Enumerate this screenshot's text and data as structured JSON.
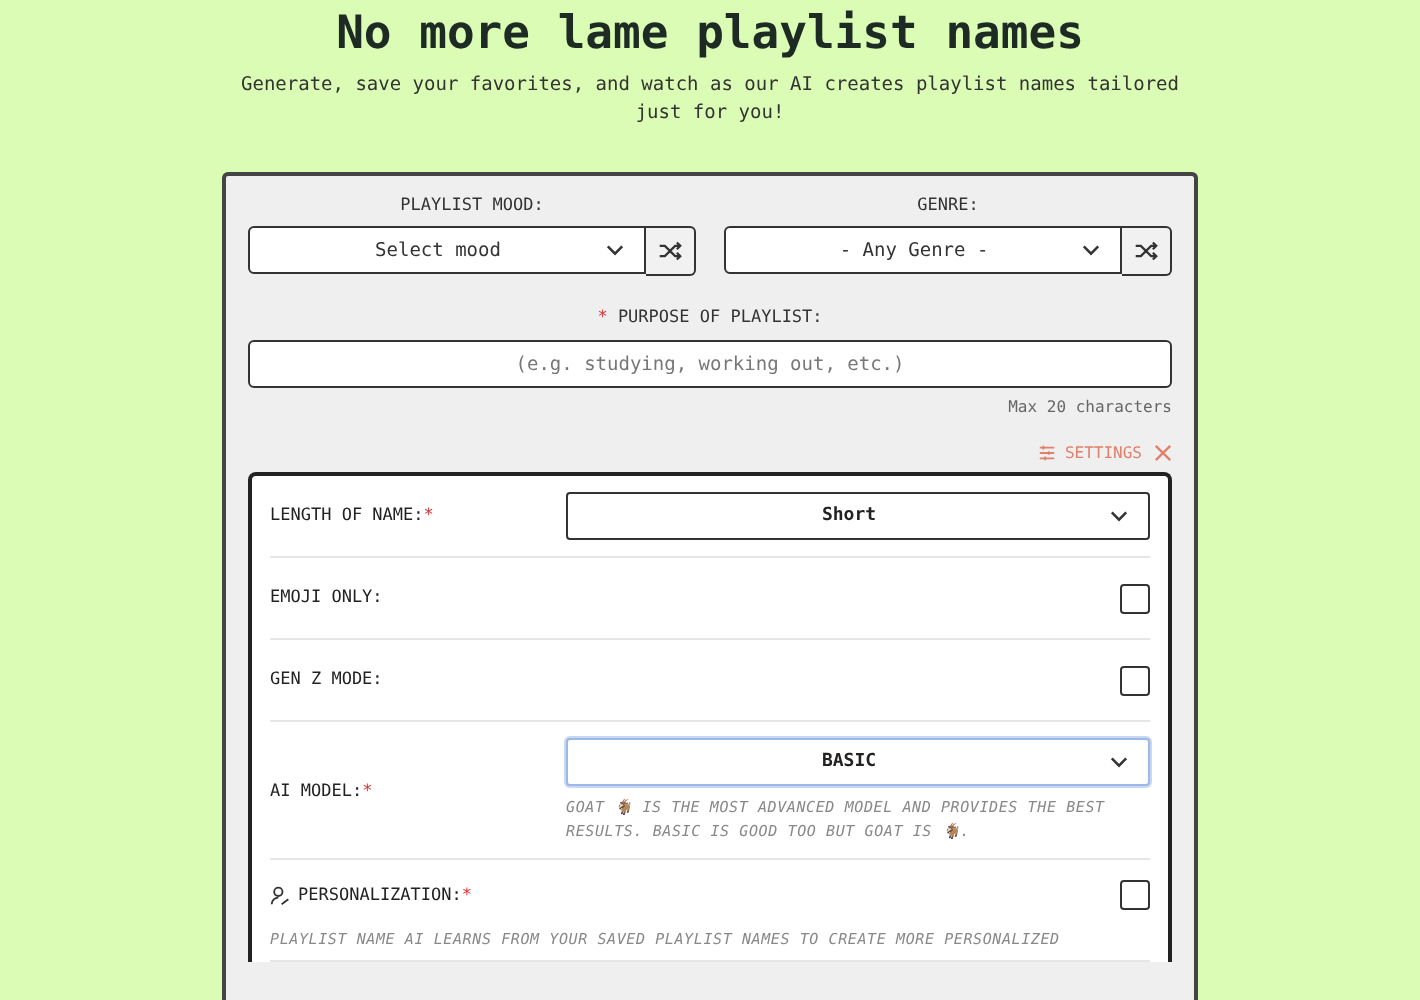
{
  "header": {
    "title": "No more lame playlist names",
    "subtitle": "Generate, save your favorites, and watch as our AI creates playlist names tailored just for you!"
  },
  "pickers": [
    {
      "label": "PLAYLIST MOOD:",
      "value": "Select mood"
    },
    {
      "label": "GENRE:",
      "value": "- Any Genre -"
    }
  ],
  "purpose": {
    "label": "PURPOSE OF PLAYLIST:",
    "required_mark": "*",
    "placeholder": "(e.g. studying, working out, etc.)",
    "hint": "Max 20 characters"
  },
  "settings_toggle": {
    "label": "SETTINGS"
  },
  "settings": [
    {
      "kind": "select",
      "label": "LENGTH OF NAME:",
      "required_mark": "*",
      "value": "Short",
      "focused": false
    },
    {
      "kind": "checkbox",
      "label": "EMOJI ONLY:",
      "checked": false
    },
    {
      "kind": "checkbox",
      "label": "GEN Z MODE:",
      "checked": false
    },
    {
      "kind": "select",
      "label": "AI MODEL:",
      "required_mark": "*",
      "value": "BASIC",
      "focused": true,
      "note": "GOAT 🐐 IS THE MOST ADVANCED MODEL AND PROVIDES THE BEST RESULTS. BASIC IS GOOD TOO BUT GOAT IS 🐐."
    },
    {
      "kind": "checkbox",
      "label": "PERSONALIZATION:",
      "required_mark": "*",
      "checked": false,
      "icon": true,
      "description": "PLAYLIST NAME AI LEARNS FROM YOUR SAVED PLAYLIST NAMES TO CREATE MORE PERSONALIZED"
    }
  ]
}
